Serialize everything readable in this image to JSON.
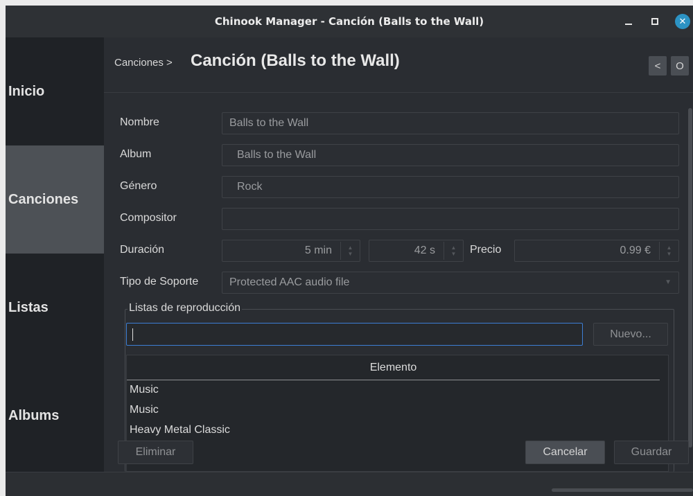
{
  "window": {
    "title": "Chinook Manager - Canción (Balls to the Wall)",
    "controls": {
      "minimize": "minimize",
      "maximize": "maximize",
      "close": "✕"
    }
  },
  "sidebar": {
    "items": [
      {
        "label": "Inicio",
        "active": false
      },
      {
        "label": "Canciones",
        "active": true
      },
      {
        "label": "Listas",
        "active": false
      },
      {
        "label": "Albums",
        "active": false
      }
    ]
  },
  "header": {
    "breadcrumb": "Canciones >",
    "title": "Canción (Balls to the Wall)",
    "prev_label": "<",
    "next_label": "O"
  },
  "form": {
    "nombre": {
      "label": "Nombre",
      "value": "Balls to the Wall"
    },
    "album": {
      "label": "Album",
      "value": "Balls to the Wall"
    },
    "genero": {
      "label": "Género",
      "value": "Rock"
    },
    "compositor": {
      "label": "Compositor",
      "value": ""
    },
    "duracion": {
      "label": "Duración",
      "minutes": "5 min",
      "seconds": "42 s"
    },
    "precio": {
      "label": "Precio",
      "value": "0.99 €"
    },
    "tipo_soporte": {
      "label": "Tipo de Soporte",
      "value": "Protected AAC audio file"
    }
  },
  "playlists": {
    "group_title": "Listas de reproducción",
    "input_value": "",
    "new_label": "Nuevo...",
    "column_header": "Elemento",
    "rows": [
      "Music",
      "Music",
      "Heavy Metal Classic"
    ]
  },
  "actions": {
    "delete_label": "Eliminar",
    "cancel_label": "Cancelar",
    "save_label": "Guardar"
  },
  "colors": {
    "accent": "#2c93c4",
    "focus_border": "#3d7fd6",
    "sidebar_active": "#4d5156"
  }
}
